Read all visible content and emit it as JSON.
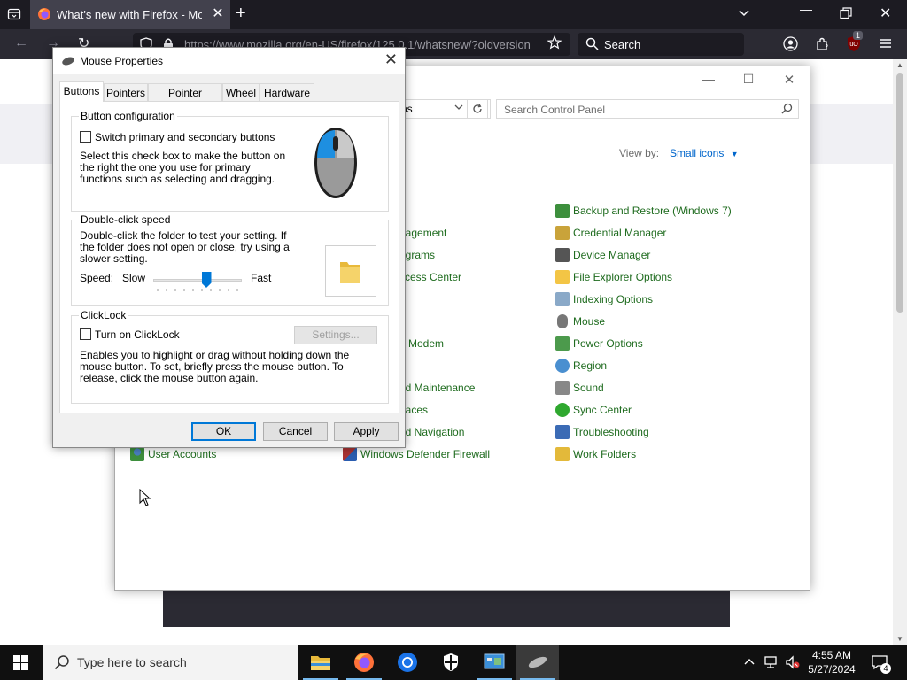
{
  "browser": {
    "tab_title": "What's new with Firefox - More",
    "url": "https://www.mozilla.org/en-US/firefox/125.0.1/whatsnew/?oldversion",
    "search_placeholder": "Search",
    "extension_badge": "1"
  },
  "control_panel": {
    "address_partial": "ns",
    "search_placeholder": "Search Control Panel",
    "view_by_label": "View by:",
    "view_by_value": "Small icons",
    "column_middle": [
      "nagement",
      "ograms",
      "ccess Center",
      "d Modem",
      "nd Maintenance",
      "paces",
      "nd Navigation",
      "Windows Defender Firewall"
    ],
    "column_left": [
      "User Accounts"
    ],
    "column_right": [
      "Backup and Restore (Windows 7)",
      "Credential Manager",
      "Device Manager",
      "File Explorer Options",
      "Indexing Options",
      "Mouse",
      "Power Options",
      "Region",
      "Sound",
      "Sync Center",
      "Troubleshooting",
      "Work Folders"
    ]
  },
  "mouse_properties": {
    "title": "Mouse Properties",
    "tabs": [
      "Buttons",
      "Pointers",
      "Pointer Options",
      "Wheel",
      "Hardware"
    ],
    "active_tab": "Buttons",
    "button_config": {
      "title": "Button configuration",
      "checkbox_label": "Switch primary and secondary buttons",
      "checked": false,
      "description": "Select this check box to make the button on the right the one you use for primary functions such as selecting and dragging."
    },
    "double_click": {
      "title": "Double-click speed",
      "description": "Double-click the folder to test your setting. If the folder does not open or close, try using a slower setting.",
      "speed_label": "Speed:",
      "slow_label": "Slow",
      "fast_label": "Fast",
      "slider_value": 0.6
    },
    "clicklock": {
      "title": "ClickLock",
      "checkbox_label": "Turn on ClickLock",
      "checked": false,
      "settings_label": "Settings...",
      "description": "Enables you to highlight or drag without holding down the mouse button. To set, briefly press the mouse button. To release, click the mouse button again."
    },
    "buttons": {
      "ok": "OK",
      "cancel": "Cancel",
      "apply": "Apply"
    }
  },
  "taskbar": {
    "search_placeholder": "Type here to search",
    "time": "4:55 AM",
    "date": "5/27/2024",
    "notification_count": "4"
  }
}
